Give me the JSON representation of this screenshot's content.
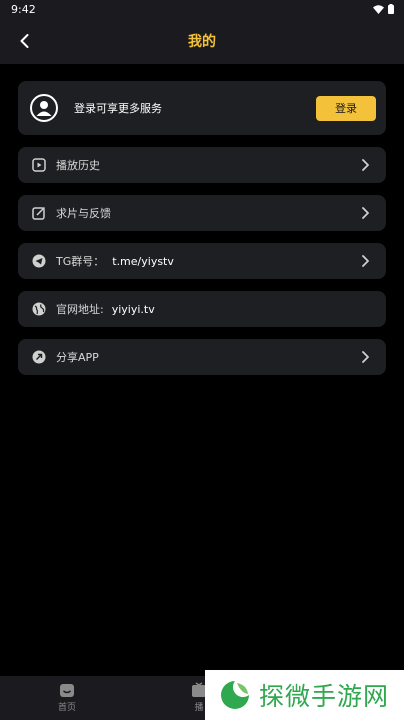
{
  "status_bar": {
    "time": "9:42"
  },
  "header": {
    "title": "我的"
  },
  "login": {
    "prompt": "登录可享更多服务",
    "button_label": "登录"
  },
  "menu": [
    {
      "label": "播放历史",
      "value": "",
      "icon": "play-history-icon",
      "chevron": true
    },
    {
      "label": "求片与反馈",
      "value": "",
      "icon": "edit-icon",
      "chevron": true
    },
    {
      "label": "TG群号：",
      "value": "t.me/yiystv",
      "icon": "telegram-icon",
      "chevron": true
    },
    {
      "label": "官网地址:",
      "value": "yiyiyi.tv",
      "icon": "globe-icon",
      "chevron": false
    },
    {
      "label": "分享APP",
      "value": "",
      "icon": "share-icon",
      "chevron": true
    }
  ],
  "bottom_nav": [
    {
      "label": "首页",
      "icon": "home-icon"
    },
    {
      "label": "播",
      "icon": "play-tab-icon"
    }
  ],
  "watermark": {
    "text": "探微手游网"
  },
  "colors": {
    "accent": "#f4c23a",
    "card": "#1e1f22",
    "background": "#000000",
    "bar": "#1b1b1f"
  }
}
